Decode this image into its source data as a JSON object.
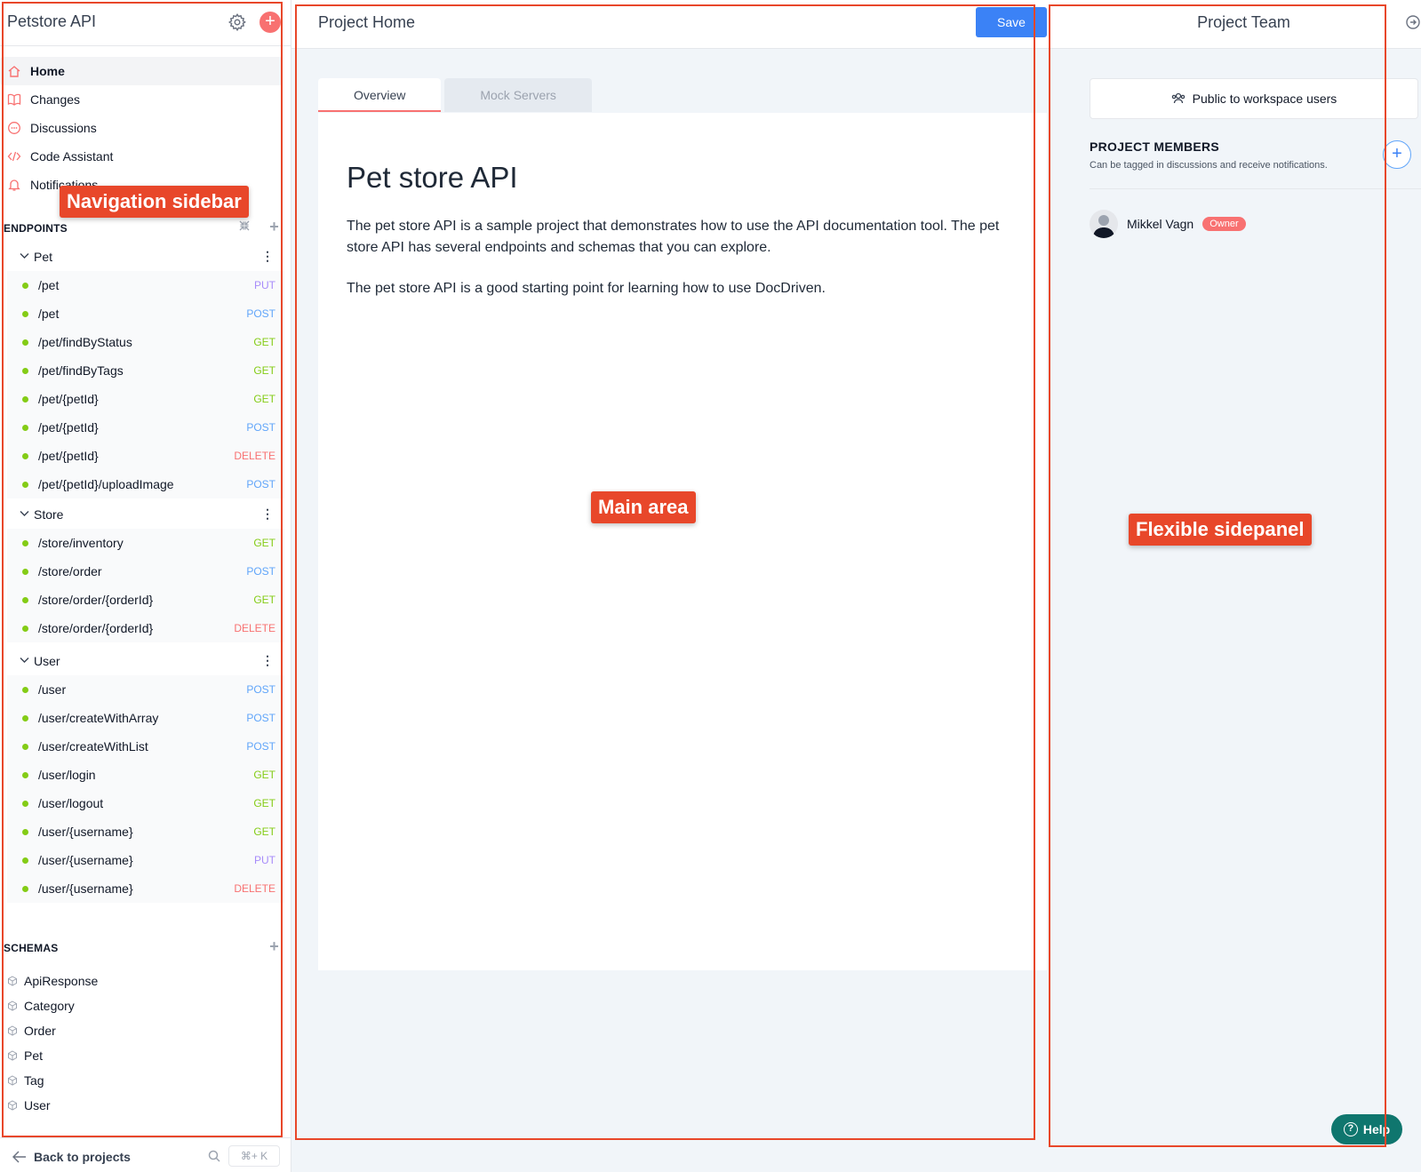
{
  "sidebar": {
    "title": "Petstore API",
    "nav": [
      {
        "label": "Home",
        "icon": "home-icon"
      },
      {
        "label": "Changes",
        "icon": "book-icon"
      },
      {
        "label": "Discussions",
        "icon": "chat-icon"
      },
      {
        "label": "Code Assistant",
        "icon": "code-icon"
      },
      {
        "label": "Notifications",
        "icon": "bell-icon"
      }
    ],
    "endpoints_label": "ENDPOINTS",
    "groups": [
      {
        "name": "Pet",
        "endpoints": [
          {
            "path": "/pet",
            "method": "PUT"
          },
          {
            "path": "/pet",
            "method": "POST"
          },
          {
            "path": "/pet/findByStatus",
            "method": "GET"
          },
          {
            "path": "/pet/findByTags",
            "method": "GET"
          },
          {
            "path": "/pet/{petId}",
            "method": "GET"
          },
          {
            "path": "/pet/{petId}",
            "method": "POST"
          },
          {
            "path": "/pet/{petId}",
            "method": "DELETE"
          },
          {
            "path": "/pet/{petId}/uploadImage",
            "method": "POST"
          }
        ]
      },
      {
        "name": "Store",
        "endpoints": [
          {
            "path": "/store/inventory",
            "method": "GET"
          },
          {
            "path": "/store/order",
            "method": "POST"
          },
          {
            "path": "/store/order/{orderId}",
            "method": "GET"
          },
          {
            "path": "/store/order/{orderId}",
            "method": "DELETE"
          }
        ]
      },
      {
        "name": "User",
        "endpoints": [
          {
            "path": "/user",
            "method": "POST"
          },
          {
            "path": "/user/createWithArray",
            "method": "POST"
          },
          {
            "path": "/user/createWithList",
            "method": "POST"
          },
          {
            "path": "/user/login",
            "method": "GET"
          },
          {
            "path": "/user/logout",
            "method": "GET"
          },
          {
            "path": "/user/{username}",
            "method": "GET"
          },
          {
            "path": "/user/{username}",
            "method": "PUT"
          },
          {
            "path": "/user/{username}",
            "method": "DELETE"
          }
        ]
      }
    ],
    "schemas_label": "SCHEMAS",
    "schemas": [
      "ApiResponse",
      "Category",
      "Order",
      "Pet",
      "Tag",
      "User"
    ],
    "back_label": "Back to projects",
    "shortcut": "⌘+ K"
  },
  "main": {
    "title": "Project Home",
    "save_label": "Save",
    "tabs": [
      "Overview",
      "Mock Servers"
    ],
    "doc_title": "Pet store API",
    "paragraphs": [
      "The pet store API is a sample project that demonstrates how to use the API documentation tool. The pet store API has several endpoints and schemas that you can explore.",
      "The pet store API is a good starting point for learning how to use DocDriven."
    ]
  },
  "panel": {
    "title": "Project Team",
    "visibility": "Public to workspace users",
    "members_title": "PROJECT MEMBERS",
    "members_sub": "Can be tagged in discussions and receive notifications.",
    "members": [
      {
        "name": "Mikkel Vagn",
        "role": "Owner"
      }
    ],
    "help_label": "Help"
  },
  "annotations": {
    "sidebar": "Navigation sidebar",
    "main": "Main area",
    "panel": "Flexible sidepanel"
  },
  "colors": {
    "accent_red": "#f87171",
    "save_blue": "#3b82f6",
    "annotation": "#e8472a",
    "help_teal": "#0f766e"
  }
}
